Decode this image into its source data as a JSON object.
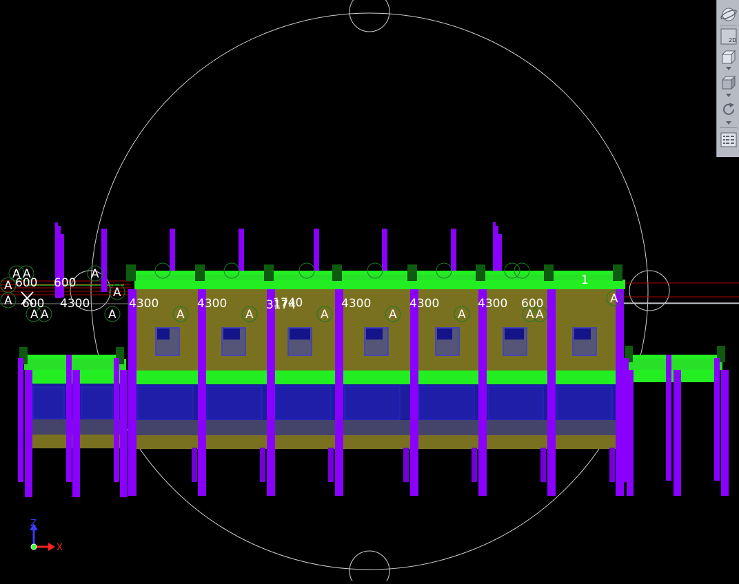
{
  "dims": {
    "d1": "4300",
    "d2": "4300",
    "d3": "4300",
    "d4": "3174",
    "d5": "1740",
    "d6": "4300",
    "d7": "4300",
    "d8": "4300",
    "d9": "600",
    "d10": "600",
    "d11": "4300",
    "d12": "600",
    "d13": "1"
  },
  "grid_marker": "A",
  "axes": {
    "z_label": "Z",
    "x_label": "X"
  },
  "toolbar": {
    "buttons": [
      "orbit-icon",
      "view-2d-icon",
      "view-cube-wireframe-icon",
      "view-cube-solid-icon",
      "rotate-icon",
      "properties-icon"
    ],
    "view_2d_text": "2D"
  },
  "colors": {
    "background": "#000000",
    "slab": "#22ee22",
    "column": "#8a00ff",
    "wall": "#7a7120",
    "glass": "#1c1c9c",
    "dimension_text": "#ffffff",
    "marker": "#1d7a2a",
    "orbit_circle": "#cfcfcf"
  }
}
